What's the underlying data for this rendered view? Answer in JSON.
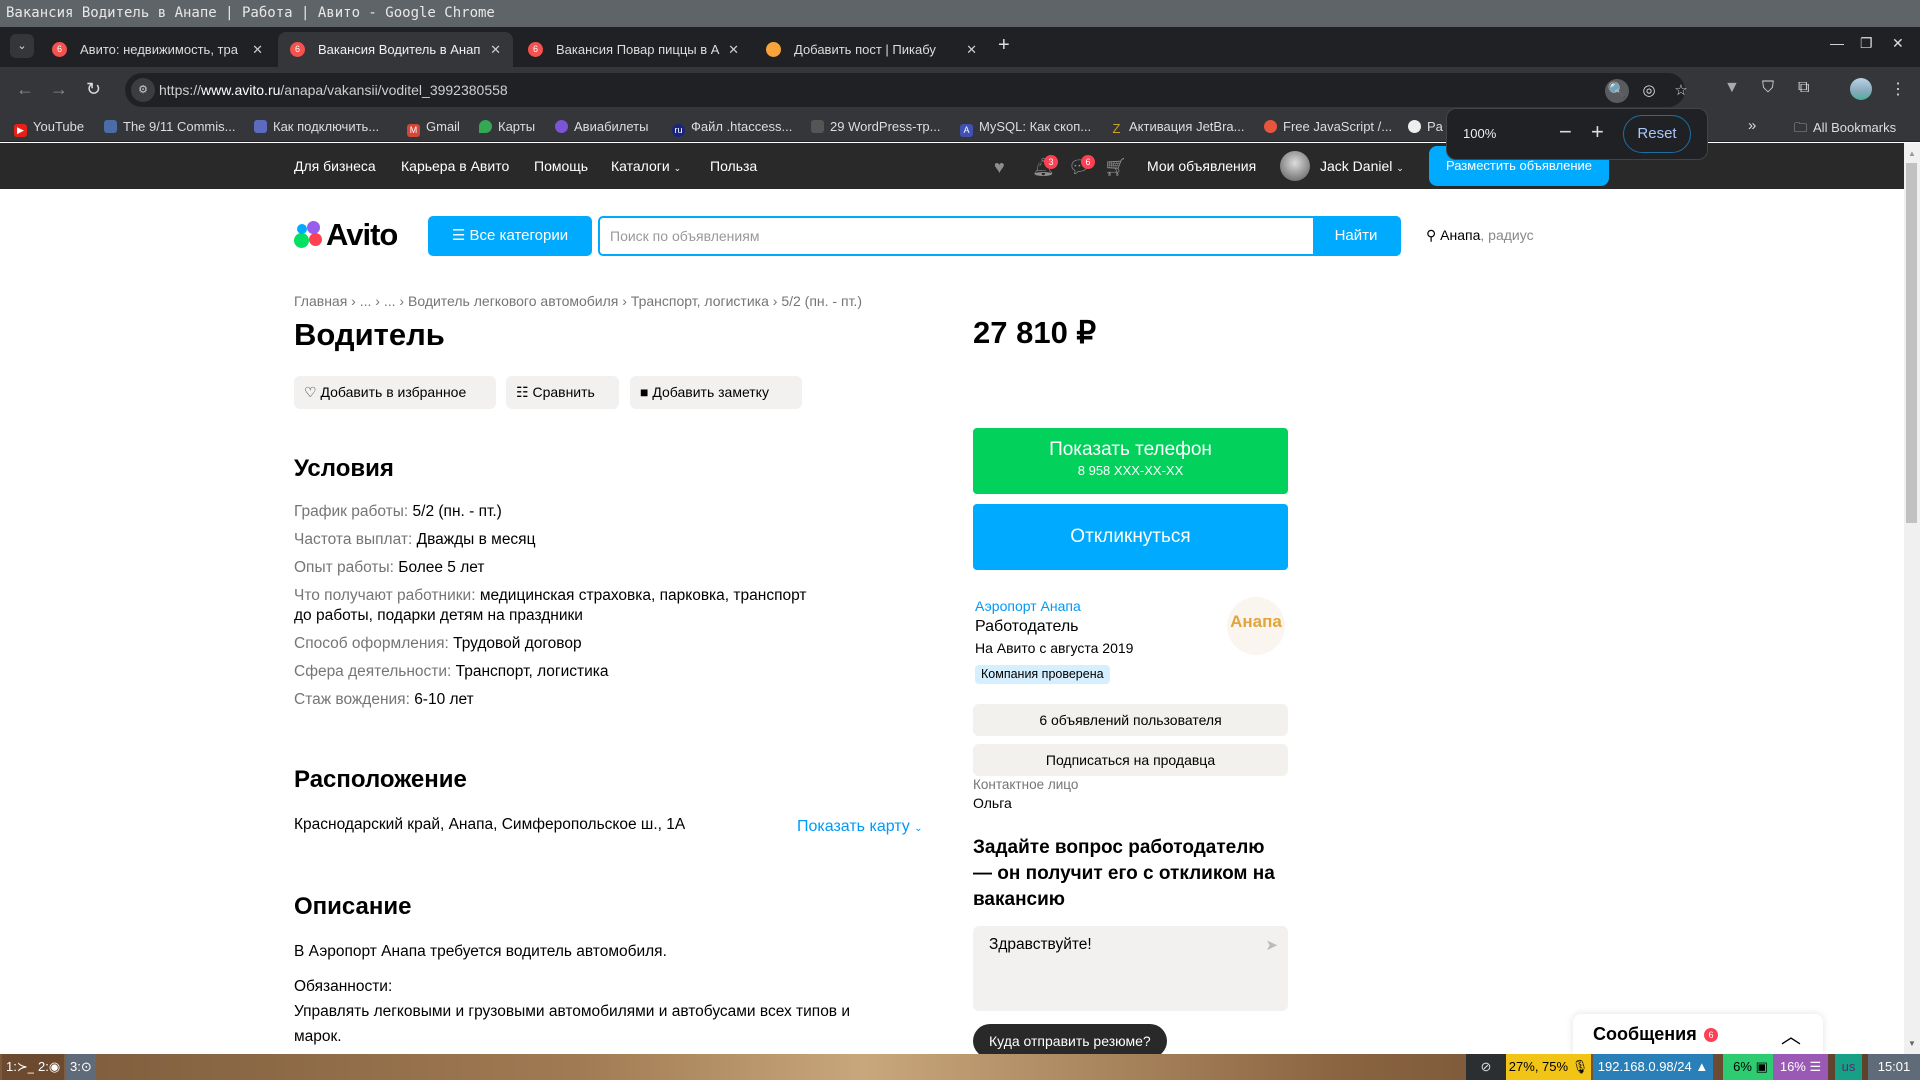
{
  "window": {
    "title": "Вакансия Водитель в Анапе | Работа | Авито - Google Chrome"
  },
  "tabs": [
    {
      "label": "Авито: недвижимость, тра",
      "badge": "6"
    },
    {
      "label": "Вакансия Водитель в Анап",
      "badge": "6",
      "active": true
    },
    {
      "label": "Вакансия Повар пиццы в А",
      "badge": "6"
    },
    {
      "label": "Добавить пост | Пикабу"
    }
  ],
  "toolbar": {
    "url_prefix": "https://",
    "url_host": "www.avito.ru",
    "url_path": "/anapa/vakansii/voditel_3992380558"
  },
  "bookmarks": [
    {
      "label": "YouTube",
      "icon_color": "#e62117"
    },
    {
      "label": "The 9/11 Commis...",
      "icon_color": "#4a6da7"
    },
    {
      "label": "Как подключить...",
      "icon_color": "#5c6bc0"
    },
    {
      "label": "Gmail",
      "icon_color": "#d44638"
    },
    {
      "label": "Карты",
      "icon_color": "#34a853"
    },
    {
      "label": "Авиабилеты",
      "icon_color": "#7b55d6"
    },
    {
      "label": "Файл .htaccess...",
      "icon_color": "#1a237e"
    },
    {
      "label": "29 WordPress-тр...",
      "icon_color": "#555555"
    },
    {
      "label": "MySQL: Как скоп...",
      "icon_color": "#3f51b5"
    },
    {
      "label": "Активация JetBra...",
      "icon_color": "#c9a227"
    },
    {
      "label": "Free JavaScript /...",
      "icon_color": "#e8553e"
    },
    {
      "label": "Pa",
      "icon_color": "#e0e0e0"
    }
  ],
  "bookmarks_more": "»",
  "all_bookmarks": "All Bookmarks",
  "zoom_popup": {
    "value": "100%",
    "minus": "−",
    "plus": "+",
    "reset": "Reset"
  },
  "topnav": {
    "links": [
      "Для бизнеса",
      "Карьера в Авито",
      "Помощь",
      "Каталоги",
      "Польза"
    ],
    "notifications_badge": "3",
    "messages_badge": "6",
    "my_ads": "Мои объявления",
    "user": "Jack Daniel",
    "post_ad": "Разместить объявление"
  },
  "header": {
    "logo": "Avito",
    "all_categories": "Все категории",
    "search_placeholder": "Поиск по объявлениям",
    "search_button": "Найти",
    "location": "Анапа",
    "location_suffix": ", радиус"
  },
  "listing": {
    "breadcrumbs": [
      "Главная",
      "...",
      "...",
      "Водитель легкового автомобиля",
      "Транспорт, логистика",
      "5/2 (пн. - пт.)"
    ],
    "title": "Водитель",
    "actions": {
      "favorite": "Добавить в избранное",
      "compare": "Сравнить",
      "note": "Добавить заметку"
    },
    "conditions_title": "Условия",
    "conditions": [
      {
        "key": "График работы:",
        "value": "5/2 (пн. - пт.)"
      },
      {
        "key": "Частота выплат:",
        "value": "Дважды в месяц"
      },
      {
        "key": "Опыт работы:",
        "value": "Более 5 лет"
      },
      {
        "key": "Что получают работники:",
        "value": "медицинская страховка, парковка, транспорт",
        "value2": "до работы, подарки детям на праздники"
      },
      {
        "key": "Способ оформления:",
        "value": "Трудовой договор"
      },
      {
        "key": "Сфера деятельности:",
        "value": "Транспорт, логистика"
      },
      {
        "key": "Стаж вождения:",
        "value": "6-10 лет"
      }
    ],
    "location_title": "Расположение",
    "address": "Краснодарский край, Анапа, Симферопольское ш., 1А",
    "show_map": "Показать карту",
    "description_title": "Описание",
    "description": [
      "В Аэропорт Анапа требуется водитель автомобиля.",
      "Обязанности:",
      "Управлять легковыми и грузовыми автомобилями и автобусами всех типов и",
      "марок."
    ]
  },
  "sidebar": {
    "price": "27 810 ₽",
    "show_phone": "Показать телефон",
    "phone_masked": "8 958 XXX-XX-XX",
    "respond": "Откликнуться",
    "seller_name": "Аэропорт Анапа",
    "seller_type": "Работодатель",
    "seller_since": "На Авито с августа 2019",
    "verified": "Компания проверена",
    "seller_logo_text": "Анапа",
    "user_ads": "6 объявлений пользователя",
    "subscribe": "Подписаться на продавца",
    "contact_label": "Контактное лицо",
    "contact_name": "Ольга",
    "ask_title": "Задайте вопрос работодателю — он получит его с откликом на вакансию",
    "ask_value": "Здравствуйте!",
    "resume_chip": "Куда отправить резюме?"
  },
  "messages_panel": {
    "title": "Сообщения",
    "badge": "6"
  },
  "taskbar": {
    "workspaces": [
      "1:",
      "2:",
      "3:"
    ],
    "battery": "27%, 75%",
    "ip": "192.168.0.98/24",
    "cpu": "6%",
    "mem": "16%",
    "layout": "us",
    "time": "15:01"
  }
}
